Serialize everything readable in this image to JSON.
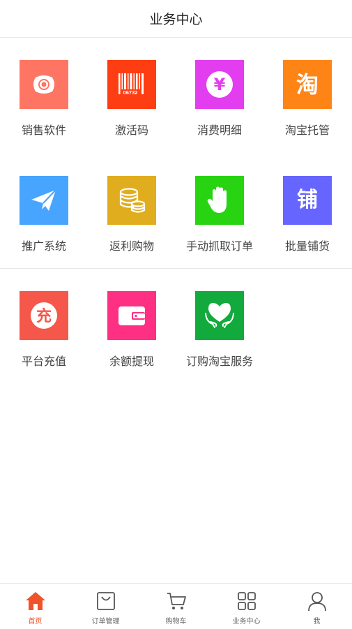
{
  "header": {
    "title": "业务中心"
  },
  "tiles": [
    {
      "label": "销售软件",
      "color": "#ff7563",
      "icon": "camera-icon"
    },
    {
      "label": "激活码",
      "color": "#ff3d12",
      "icon": "barcode-icon",
      "code": "06732"
    },
    {
      "label": "消费明细",
      "color": "#e33df0",
      "icon": "yen-icon",
      "glyph": "¥"
    },
    {
      "label": "淘宝托管",
      "color": "#ff8416",
      "icon": "taobao-icon",
      "glyph": "淘"
    },
    {
      "label": "推广系统",
      "color": "#47a4ff",
      "icon": "paper-plane-icon"
    },
    {
      "label": "返利购物",
      "color": "#e0ad1e",
      "icon": "coins-icon"
    },
    {
      "label": "手动抓取订单",
      "color": "#28d411",
      "icon": "hand-icon"
    },
    {
      "label": "批量铺货",
      "color": "#6665ff",
      "icon": "shop-icon",
      "glyph": "铺"
    },
    {
      "label": "平台充值",
      "color": "#f5574b",
      "icon": "recharge-icon",
      "glyph": "充"
    },
    {
      "label": "余额提现",
      "color": "#ff2f84",
      "icon": "wallet-icon"
    },
    {
      "label": "订购淘宝服务",
      "color": "#13aa3d",
      "icon": "heart-hands-icon"
    }
  ],
  "tabbar": {
    "active_color": "#f0532a",
    "items": [
      {
        "label": "首页",
        "icon": "home-icon"
      },
      {
        "label": "订单管理",
        "icon": "bag-icon"
      },
      {
        "label": "购物车",
        "icon": "cart-icon"
      },
      {
        "label": "业务中心",
        "icon": "grid-icon"
      },
      {
        "label": "我",
        "icon": "user-icon"
      }
    ]
  }
}
